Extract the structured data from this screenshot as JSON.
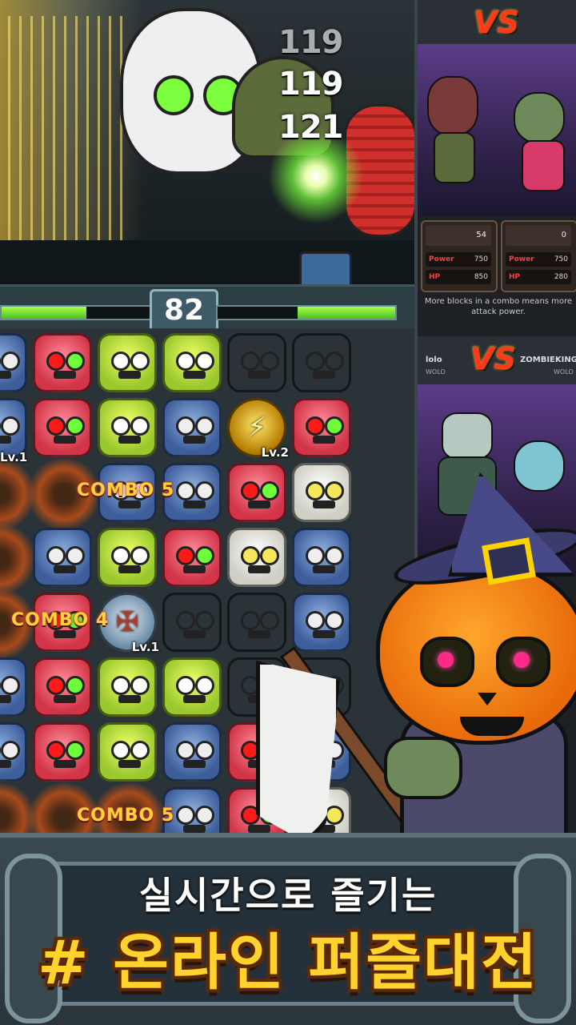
{
  "battle": {
    "damage_numbers": [
      "119",
      "119",
      "121"
    ],
    "turn_timer": "82",
    "player_hp_fraction": 0.57,
    "enemy_hp_fraction": 0.55
  },
  "board": {
    "rows": [
      [
        "helmet",
        "cat",
        "zombie",
        "zombie",
        "pumpkin",
        "pumpkin"
      ],
      [
        "helmet",
        "cat",
        "zombie",
        "helmet",
        "bolt",
        "cat"
      ],
      [
        "blast",
        "blast",
        "helmet",
        "helmet",
        "cat",
        "bear"
      ],
      [
        "blast",
        "helmet",
        "zombie",
        "cat",
        "bear",
        "helmet"
      ],
      [
        "blast",
        "cat",
        "shield",
        "pumpkin",
        "pumpkin",
        "helmet"
      ],
      [
        "helmet",
        "cat",
        "zombie",
        "zombie",
        "pumpkin",
        "pumpkin"
      ],
      [
        "helmet",
        "cat",
        "zombie",
        "helmet",
        "cat",
        "helmet"
      ],
      [
        "blast",
        "blast",
        "blast",
        "helmet",
        "cat",
        "bear"
      ]
    ],
    "bolt_level": "Lv.2",
    "shield_level": "Lv.1",
    "edge_level": "Lv.1",
    "combo_labels": [
      "COMBO 5",
      "COMBO 4",
      "COMBO 5"
    ]
  },
  "right_panel": {
    "vs_mark": "VS",
    "match1": {
      "stats_left": {
        "score": "54",
        "power_label": "Power",
        "power": "750",
        "hp_label": "HP",
        "hp": "850"
      },
      "stats_right": {
        "score": "0",
        "power_label": "Power",
        "power": "750",
        "hp_label": "HP",
        "hp": "280"
      },
      "tip": "More blocks in a combo means more attack power."
    },
    "match2": {
      "player_left": "lolo",
      "rank_left": "WOLO",
      "player_right": "ZOMBIEKING",
      "rank_right": "WOLO"
    }
  },
  "banner": {
    "line1": "실시간으로 즐기는",
    "line2": "# 온라인 퍼즐대전"
  },
  "colors": {
    "title_yellow": "#ffd22e",
    "hp_green": "#6fe033",
    "combo_gold": "#ffd23a"
  }
}
